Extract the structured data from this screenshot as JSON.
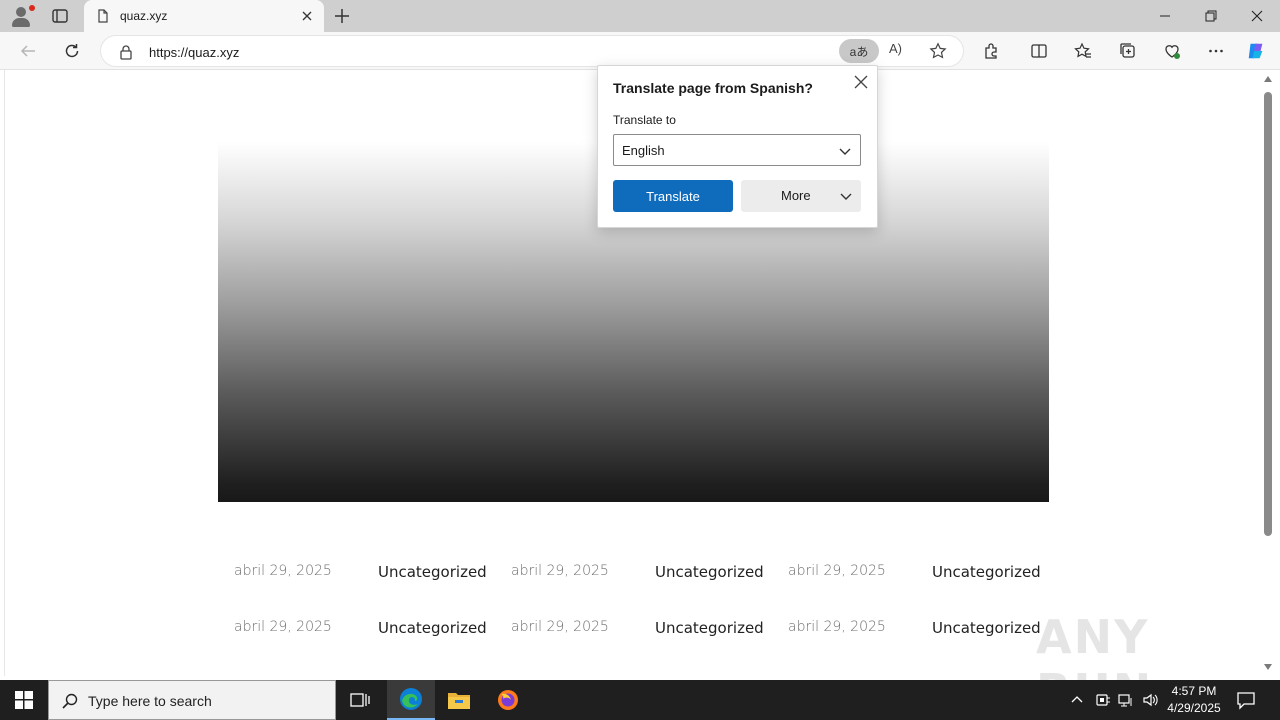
{
  "browser": {
    "tab": {
      "title": "quaz.xyz"
    },
    "address": {
      "url": "https://quaz.xyz"
    },
    "translate_indicator": "aあ",
    "read_aloud": "A)"
  },
  "translate_popup": {
    "title": "Translate page from Spanish?",
    "label": "Translate to",
    "selected_language": "English",
    "translate_button": "Translate",
    "more_button": "More"
  },
  "page": {
    "posts": [
      {
        "date": "abril 29, 2025",
        "category": "Uncategorized"
      },
      {
        "date": "abril 29, 2025",
        "category": "Uncategorized"
      },
      {
        "date": "abril 29, 2025",
        "category": "Uncategorized"
      },
      {
        "date": "abril 29, 2025",
        "category": "Uncategorized"
      },
      {
        "date": "abril 29, 2025",
        "category": "Uncategorized"
      },
      {
        "date": "abril 29, 2025",
        "category": "Uncategorized"
      }
    ],
    "watermark": "ANY RUN"
  },
  "taskbar": {
    "search_placeholder": "Type here to search",
    "time": "4:57 PM",
    "date": "4/29/2025"
  },
  "colors": {
    "accent": "#0f6cbd",
    "taskbar": "#1f1f1f",
    "tabstrip": "#cfcfcf"
  }
}
